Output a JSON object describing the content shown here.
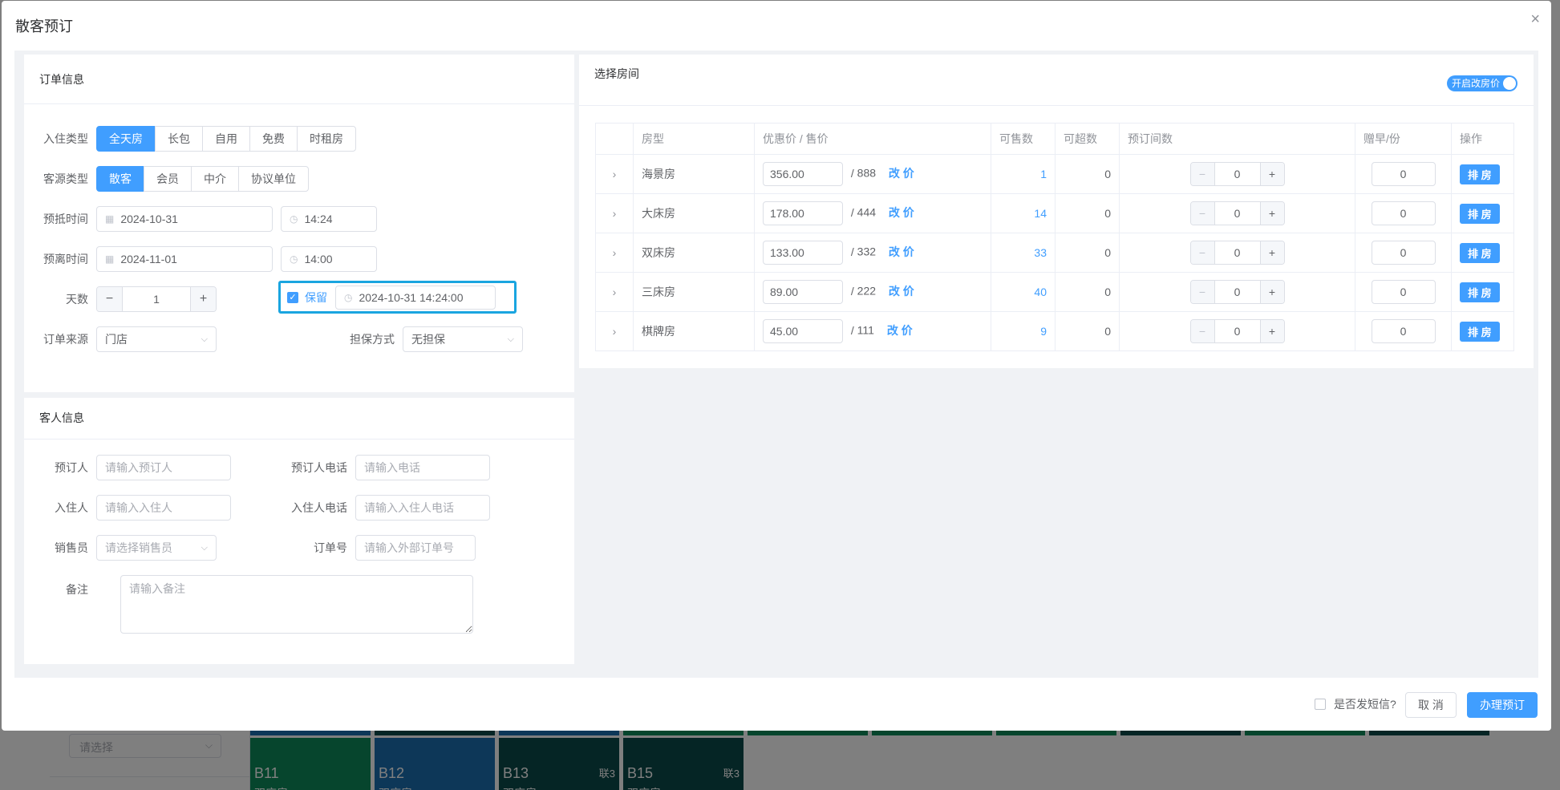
{
  "background": {
    "select_placeholder": "请选择",
    "tiles": [
      {
        "num": "B11",
        "type": "双床房",
        "lian": "",
        "color": "#0d8a5a"
      },
      {
        "num": "B12",
        "type": "双床房",
        "lian": "",
        "color": "#1a6fb0"
      },
      {
        "num": "B13",
        "type": "双床房",
        "lian": "联3",
        "color": "#0b4a4a"
      },
      {
        "num": "B15",
        "type": "双床房",
        "lian": "联3",
        "color": "#0b4a4a"
      }
    ]
  },
  "dialog": {
    "title": "散客预订",
    "close": "×"
  },
  "order": {
    "header": "订单信息",
    "checkin_type_label": "入住类型",
    "checkin_types": [
      "全天房",
      "长包",
      "自用",
      "免费",
      "时租房"
    ],
    "source_type_label": "客源类型",
    "source_types": [
      "散客",
      "会员",
      "中介",
      "协议单位"
    ],
    "arrive_label": "预抵时间",
    "arrive_date": "2024-10-31",
    "arrive_time": "14:24",
    "leave_label": "预离时间",
    "leave_date": "2024-11-01",
    "leave_time": "14:00",
    "days_label": "天数",
    "days_value": "1",
    "keep_label": "保留",
    "keep_datetime": "2024-10-31 14:24:00",
    "order_source_label": "订单来源",
    "order_source_value": "门店",
    "guarantee_label": "担保方式",
    "guarantee_value": "无担保"
  },
  "guest": {
    "header": "客人信息",
    "booker_label": "预订人",
    "booker_placeholder": "请输入预订人",
    "booker_phone_label": "预订人电话",
    "booker_phone_placeholder": "请输入电话",
    "checkin_person_label": "入住人",
    "checkin_person_placeholder": "请输入入住人",
    "checkin_phone_label": "入住人电话",
    "checkin_phone_placeholder": "请输入入住人电话",
    "sales_label": "销售员",
    "sales_placeholder": "请选择销售员",
    "order_no_label": "订单号",
    "order_no_placeholder": "请输入外部订单号",
    "remark_label": "备注",
    "remark_placeholder": "请输入备注"
  },
  "rooms": {
    "header": "选择房间",
    "switch_label": "开启改房价",
    "columns": [
      "房型",
      "优惠价 / 售价",
      "可售数",
      "可超数",
      "预订间数",
      "赠早/份",
      "操作"
    ],
    "rows": [
      {
        "type": "海景房",
        "price": "356.00",
        "sale": "888",
        "available": "1",
        "over": "0",
        "count": "0",
        "breakfast": "0"
      },
      {
        "type": "大床房",
        "price": "178.00",
        "sale": "444",
        "available": "14",
        "over": "0",
        "count": "0",
        "breakfast": "0"
      },
      {
        "type": "双床房",
        "price": "133.00",
        "sale": "332",
        "available": "33",
        "over": "0",
        "count": "0",
        "breakfast": "0"
      },
      {
        "type": "三床房",
        "price": "89.00",
        "sale": "222",
        "available": "40",
        "over": "0",
        "count": "0",
        "breakfast": "0"
      },
      {
        "type": "棋牌房",
        "price": "45.00",
        "sale": "111",
        "available": "9",
        "over": "0",
        "count": "0",
        "breakfast": "0"
      }
    ],
    "change_price_label": "改 价",
    "assign_label": "排 房",
    "price_sep": "/ "
  },
  "footer": {
    "sms_label": "是否发短信?",
    "cancel_label": "取 消",
    "submit_label": "办理预订"
  },
  "colors": {
    "primary": "#409eff",
    "highlight": "#1aa5e0"
  }
}
